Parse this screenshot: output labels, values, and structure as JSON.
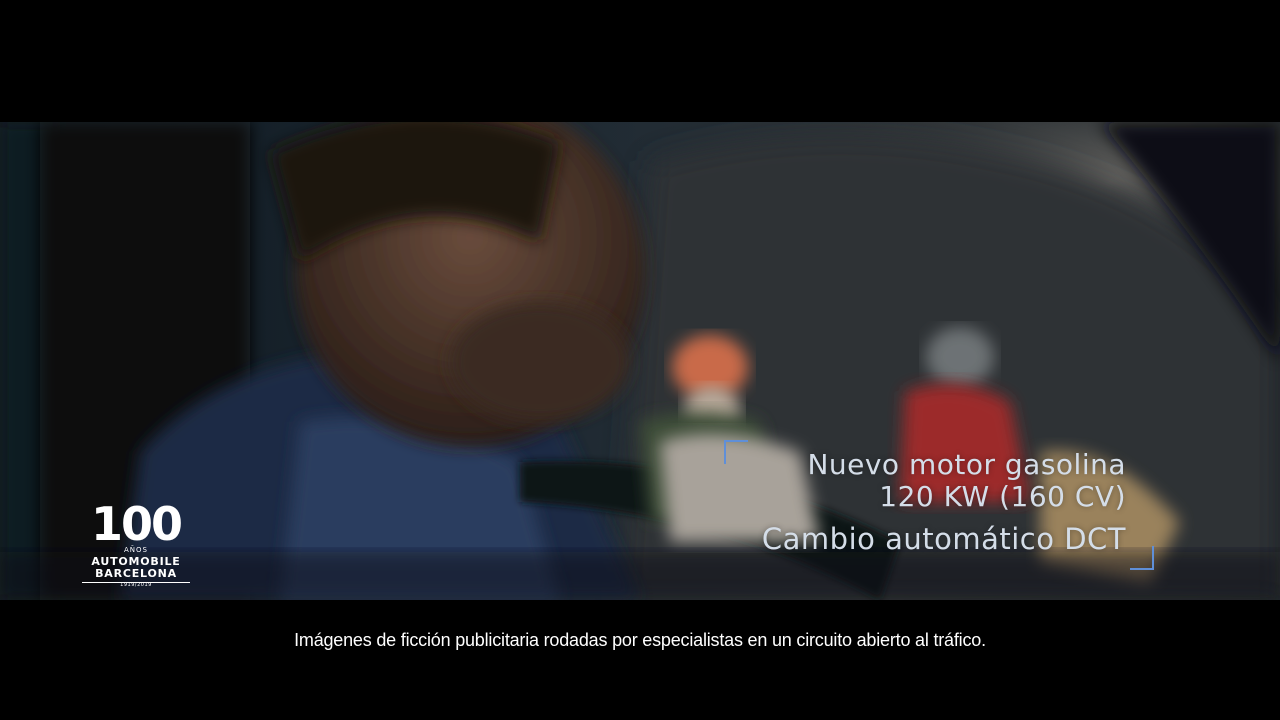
{
  "overlay": {
    "line1": "Nuevo motor gasolina",
    "line2": "120 KW (160 CV)",
    "line3": "Cambio automático DCT",
    "accent_color": "#5f8fd8"
  },
  "logo": {
    "number": "100",
    "line1": "AÑOS",
    "line2": "AUTOMOBILE",
    "line3": "BARCELONA",
    "line4": "1919/2019"
  },
  "subtitle": "Imágenes de ficción publicitaria rodadas por especialistas en un circuito abierto al tráfico."
}
